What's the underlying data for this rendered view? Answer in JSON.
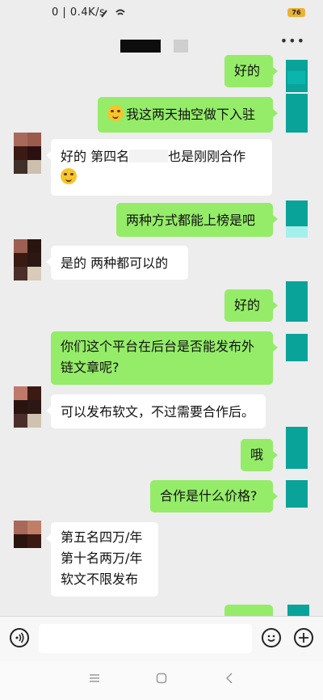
{
  "status_bar": {
    "signal_text": "0 | 0.4K/s",
    "battery": "76"
  },
  "header": {
    "more_icon": "more-dots-icon"
  },
  "messages": [
    {
      "from": "me",
      "text": "好的"
    },
    {
      "from": "me",
      "text": "我这两天抽空做下入驻",
      "emoji": "smile-emoji"
    },
    {
      "from": "them",
      "line1_a": "好的  第四名",
      "line1_b": "也是刚刚合作"
    },
    {
      "from": "me",
      "text": "两种方式都能上榜是吧"
    },
    {
      "from": "them",
      "text": "是的  两种都可以的"
    },
    {
      "from": "me",
      "text": "好的"
    },
    {
      "from": "me",
      "line1": "你们这个平台在后台是否能发布外",
      "line2": "链文章呢?"
    },
    {
      "from": "them",
      "text": "可以发布软文，不过需要合作后。"
    },
    {
      "from": "me",
      "text": "哦"
    },
    {
      "from": "me",
      "text": "合作是什么价格?"
    },
    {
      "from": "them",
      "line1": "第五名四万/年",
      "line2": "第十名两万/年",
      "line3": "软文不限发布"
    }
  ],
  "input_bar": {
    "voice_icon": "voice-icon",
    "emoji_icon": "emoji-icon",
    "plus_icon": "plus-icon"
  },
  "nav": {
    "menu_icon": "menu-icon",
    "home_icon": "home-icon",
    "back_icon": "back-icon"
  }
}
